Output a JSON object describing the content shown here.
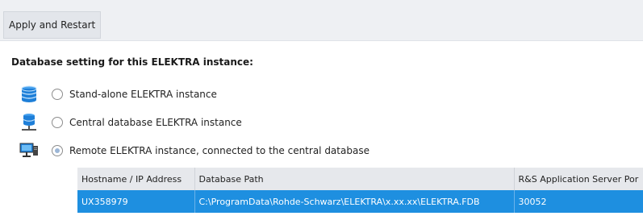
{
  "toolbar": {
    "apply_restart_label": "Apply and Restart"
  },
  "section": {
    "title": "Database setting for this ELEKTRA instance:"
  },
  "options": [
    {
      "label": "Stand-alone ELEKTRA instance",
      "icon": "database-icon",
      "selected": false
    },
    {
      "label": "Central database ELEKTRA instance",
      "icon": "server-network-icon",
      "selected": false
    },
    {
      "label": "Remote ELEKTRA instance, connected to the central database",
      "icon": "remote-computer-icon",
      "selected": true
    }
  ],
  "table": {
    "headers": [
      "Hostname / IP Address",
      "Database Path",
      "R&S Application Server Por"
    ],
    "rows": [
      [
        "UX358979",
        "C:\\ProgramData\\Rohde-Schwarz\\ELEKTRA\\x.xx.xx\\ELEKTRA.FDB",
        "30052"
      ]
    ]
  },
  "colors": {
    "toolbar_bg": "#eef0f3",
    "selected_row_bg": "#1e8fe0",
    "icon_blue": "#1e7fd8"
  }
}
